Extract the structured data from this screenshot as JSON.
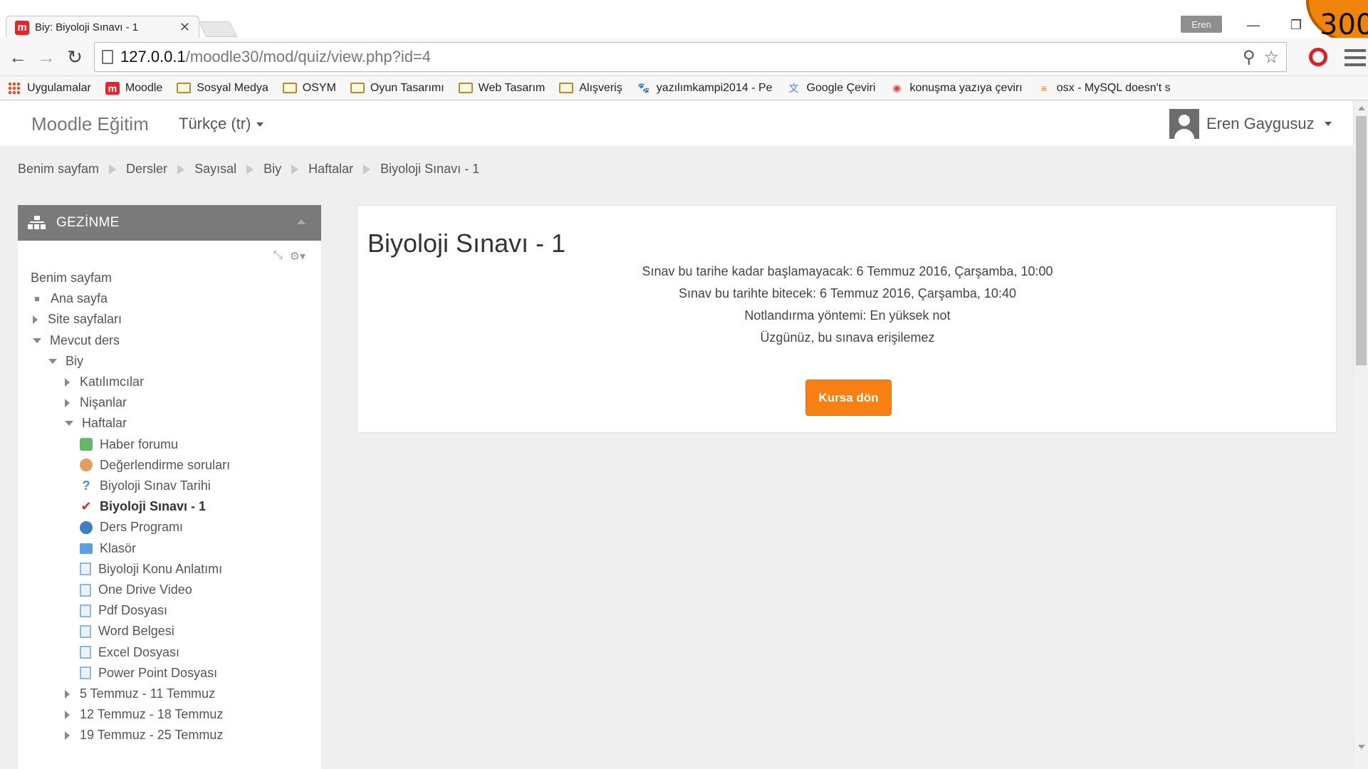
{
  "browser": {
    "tab_title": "Biy: Biyoloji Sınavı - 1",
    "tab_favicon": "m",
    "profile_name": "Eren",
    "overlay_number": "300",
    "url_host": "127.0.0.1",
    "url_path": "/moodle30/mod/quiz/view.php?id=4",
    "bookmarks": [
      {
        "label": "Uygulamalar",
        "icon": "apps-grid-icon"
      },
      {
        "label": "Moodle",
        "icon": "moodle-icon"
      },
      {
        "label": "Sosyal Medya",
        "icon": "folder-icon"
      },
      {
        "label": "OSYM",
        "icon": "folder-icon"
      },
      {
        "label": "Oyun Tasarımı",
        "icon": "folder-icon"
      },
      {
        "label": "Web Tasarım",
        "icon": "folder-icon"
      },
      {
        "label": "Alışveriş",
        "icon": "folder-icon"
      },
      {
        "label": "yazılımkampi2014 - Pe",
        "icon": "cat-icon"
      },
      {
        "label": "Google Çeviri",
        "icon": "translate-icon"
      },
      {
        "label": "konuşma yazıya çevirı",
        "icon": "chrome-icon"
      },
      {
        "label": "osx - MySQL doesn't s",
        "icon": "stackoverflow-icon"
      }
    ]
  },
  "navbar": {
    "brand": "Moodle Eğitim",
    "language": "Türkçe (tr)",
    "user_name": "Eren Gaygusuz"
  },
  "breadcrumb": [
    "Benim sayfam",
    "Dersler",
    "Sayısal",
    "Biy",
    "Haftalar",
    "Biyoloji Sınavı - 1"
  ],
  "navigation_block": {
    "title": "GEZİNME",
    "items": [
      {
        "label": "Benim sayfam",
        "marker": "none",
        "icon": "",
        "depth": 0
      },
      {
        "label": "Ana sayfa",
        "marker": "bullet",
        "icon": "",
        "depth": 1
      },
      {
        "label": "Site sayfaları",
        "marker": "collapsed",
        "icon": "",
        "depth": 1
      },
      {
        "label": "Mevcut ders",
        "marker": "expanded",
        "icon": "",
        "depth": 1
      },
      {
        "label": "Biy",
        "marker": "expanded",
        "icon": "",
        "depth": 2
      },
      {
        "label": "Katılımcılar",
        "marker": "collapsed",
        "icon": "",
        "depth": 3
      },
      {
        "label": "Nişanlar",
        "marker": "collapsed",
        "icon": "",
        "depth": 3
      },
      {
        "label": "Haftalar",
        "marker": "expanded",
        "icon": "",
        "depth": 3
      },
      {
        "label": "Haber forumu",
        "marker": "none",
        "icon": "forum-icon",
        "depth": 4
      },
      {
        "label": "Değerlendirme soruları",
        "marker": "none",
        "icon": "feedback-icon",
        "depth": 4
      },
      {
        "label": "Biyoloji Sınav Tarihi",
        "marker": "none",
        "icon": "question-icon",
        "depth": 4
      },
      {
        "label": "Biyoloji Sınavı - 1",
        "marker": "none",
        "icon": "quiz-icon",
        "depth": 4,
        "current": true
      },
      {
        "label": "Ders Programı",
        "marker": "none",
        "icon": "schedule-icon",
        "depth": 4
      },
      {
        "label": "Klasör",
        "marker": "none",
        "icon": "folder-icon",
        "depth": 4
      },
      {
        "label": "Biyoloji Konu Anlatımı",
        "marker": "none",
        "icon": "file-icon",
        "depth": 4
      },
      {
        "label": "One Drive Video",
        "marker": "none",
        "icon": "file-icon",
        "depth": 4
      },
      {
        "label": "Pdf Dosyası",
        "marker": "none",
        "icon": "file-icon",
        "depth": 4
      },
      {
        "label": "Word Belgesi",
        "marker": "none",
        "icon": "file-icon",
        "depth": 4
      },
      {
        "label": "Excel Dosyası",
        "marker": "none",
        "icon": "file-icon",
        "depth": 4
      },
      {
        "label": "Power Point Dosyası",
        "marker": "none",
        "icon": "file-icon",
        "depth": 4
      },
      {
        "label": "5 Temmuz - 11 Temmuz",
        "marker": "collapsed",
        "icon": "",
        "depth": 3
      },
      {
        "label": "12 Temmuz - 18 Temmuz",
        "marker": "collapsed",
        "icon": "",
        "depth": 3
      },
      {
        "label": "19 Temmuz - 25 Temmuz",
        "marker": "collapsed",
        "icon": "",
        "depth": 3
      }
    ]
  },
  "quiz": {
    "title": "Biyoloji Sınavı - 1",
    "open_info": "Sınav bu tarihe kadar başlamayacak: 6 Temmuz 2016, Çarşamba, 10:00",
    "close_info": "Sınav bu tarihte bitecek: 6 Temmuz 2016, Çarşamba, 10:40",
    "grading_method": "Notlandırma yöntemi: En yüksek not",
    "access_message": "Üzgünüz, bu sınava erişilemez",
    "back_button": "Kursa dön"
  },
  "colors": {
    "accent": "#f98012",
    "block_header": "#7a7a7a",
    "page_background": "#efefef"
  }
}
